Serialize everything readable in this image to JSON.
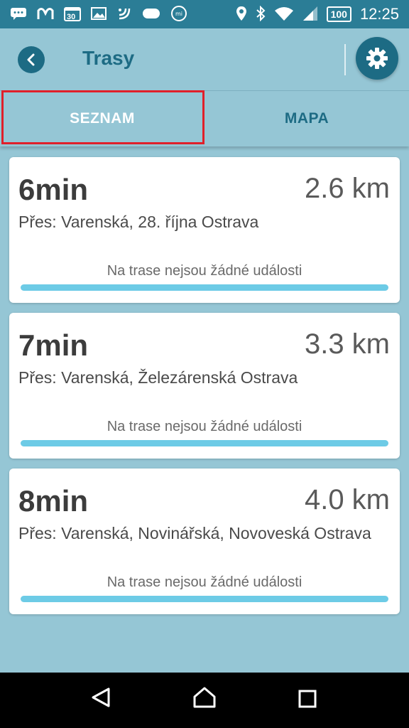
{
  "status_bar": {
    "left_icons": [
      "chat-icon",
      "m-app-icon",
      "calendar-icon",
      "image-icon",
      "nfc-icon",
      "cloud-icon",
      "mi-icon"
    ],
    "calendar_day": "30",
    "right_icons": [
      "location-icon",
      "bluetooth-icon",
      "wifi-icon",
      "signal-icon",
      "battery-icon"
    ],
    "battery": "100",
    "time": "12:25"
  },
  "header": {
    "title": "Trasy",
    "back_icon": "back-arrow-icon",
    "settings_icon": "gear-icon"
  },
  "tabs": [
    {
      "label": "SEZNAM",
      "active": true
    },
    {
      "label": "MAPA",
      "active": false
    }
  ],
  "routes": [
    {
      "time": "6min",
      "distance": "2.6 km",
      "via": "Přes: Varenská, 28. října Ostrava",
      "events": "Na trase nejsou žádné události"
    },
    {
      "time": "7min",
      "distance": "3.3 km",
      "via": "Přes: Varenská, Železárenská Ostrava",
      "events": "Na trase nejsou žádné události"
    },
    {
      "time": "8min",
      "distance": "4.0 km",
      "via": "Přes: Varenská, Novinářská, Novoveská Ostrava",
      "events": "Na trase nejsou žádné události"
    }
  ],
  "colors": {
    "background": "#95c6d5",
    "status_bar": "#2b7d96",
    "accent": "#1d6b84",
    "route_bar": "#6dcbe6",
    "highlight": "#e0202a"
  },
  "nav_bar": {
    "buttons": [
      "back-triangle-icon",
      "home-icon",
      "recents-square-icon"
    ]
  }
}
